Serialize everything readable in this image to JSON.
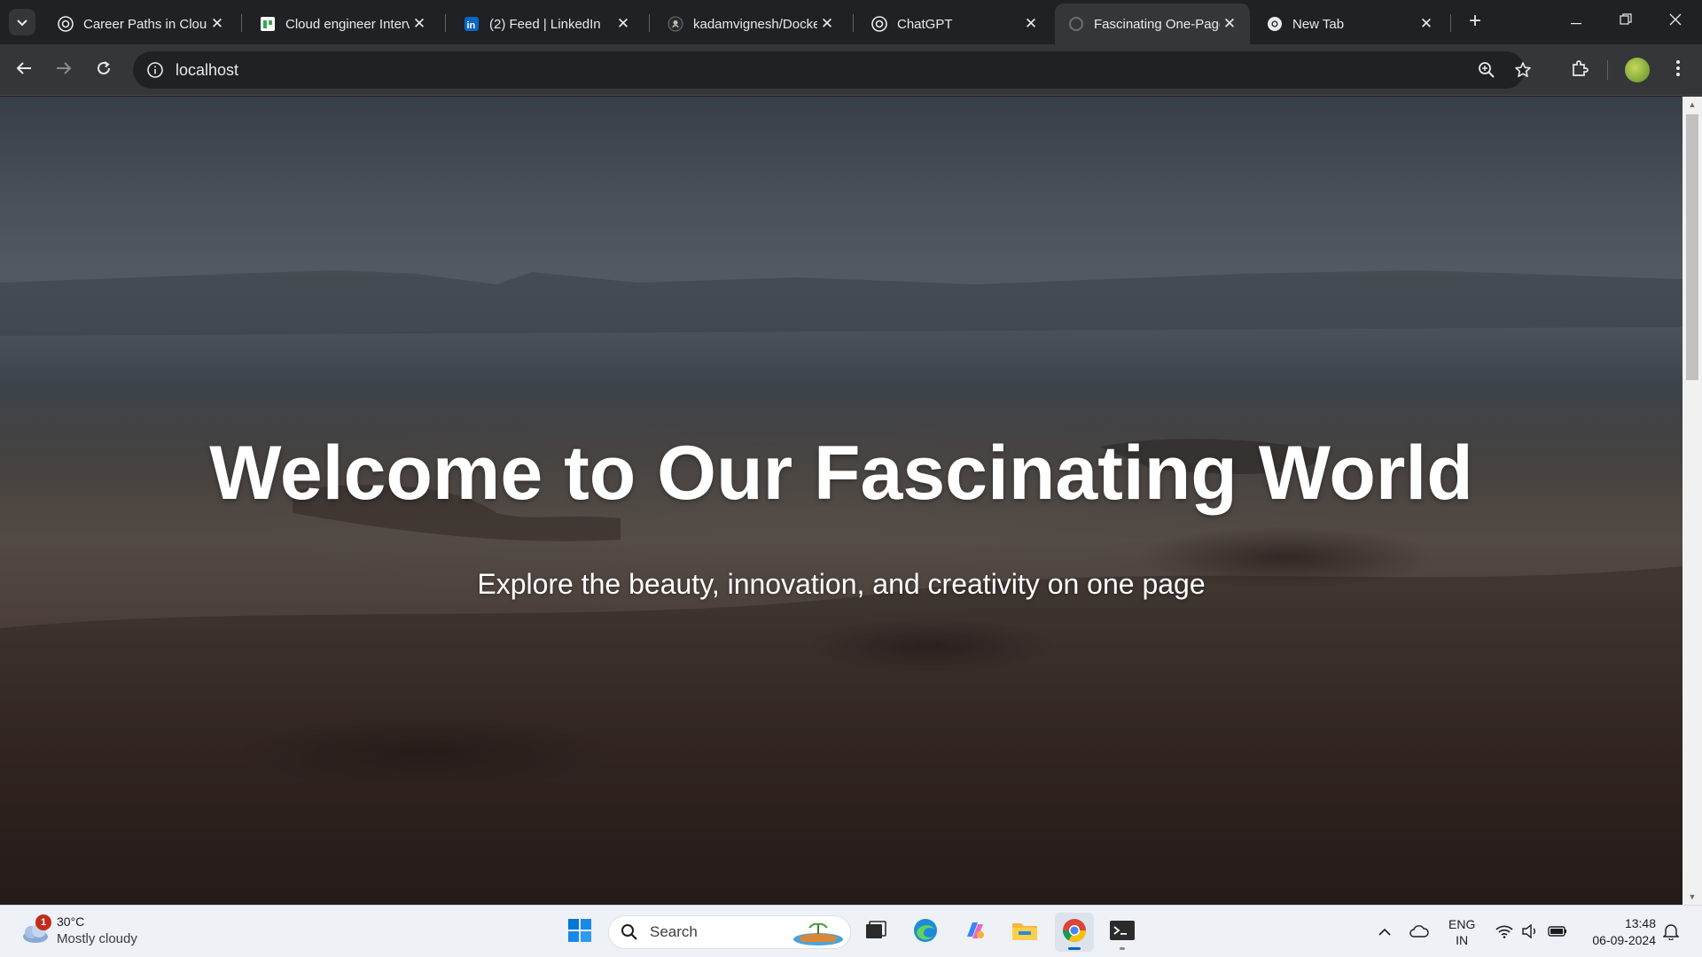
{
  "browser": {
    "tabs": [
      {
        "title": "Career Paths in Cloud",
        "favicon": "chatgpt-icon",
        "active": false
      },
      {
        "title": "Cloud engineer Interv",
        "favicon": "docs-icon",
        "active": false
      },
      {
        "title": "(2) Feed | LinkedIn",
        "favicon": "linkedin-icon",
        "active": false
      },
      {
        "title": "kadamvignesh/Docke",
        "favicon": "github-icon",
        "active": false
      },
      {
        "title": "ChatGPT",
        "favicon": "chatgpt-icon",
        "active": false
      },
      {
        "title": "Fascinating One-Page",
        "favicon": "loading-globe-icon",
        "active": true
      },
      {
        "title": "New Tab",
        "favicon": "chrome-icon",
        "active": false
      }
    ],
    "address": "localhost",
    "accent": "#35363a"
  },
  "page": {
    "hero_title": "Welcome to Our Fascinating World",
    "hero_subtitle": "Explore the beauty, innovation, and creativity on one page",
    "text_color": "#ffffff"
  },
  "taskbar": {
    "weather": {
      "temperature": "30°C",
      "condition": "Mostly cloudy",
      "badge": "1"
    },
    "search_placeholder": "Search",
    "language": {
      "line1": "ENG",
      "line2": "IN"
    },
    "clock": {
      "time": "13:48",
      "date": "06-09-2024"
    },
    "apps": [
      "start-icon",
      "search-icon",
      "task-view-icon",
      "edge-icon",
      "copilot-icon",
      "file-explorer-icon",
      "chrome-icon",
      "terminal-icon"
    ]
  }
}
